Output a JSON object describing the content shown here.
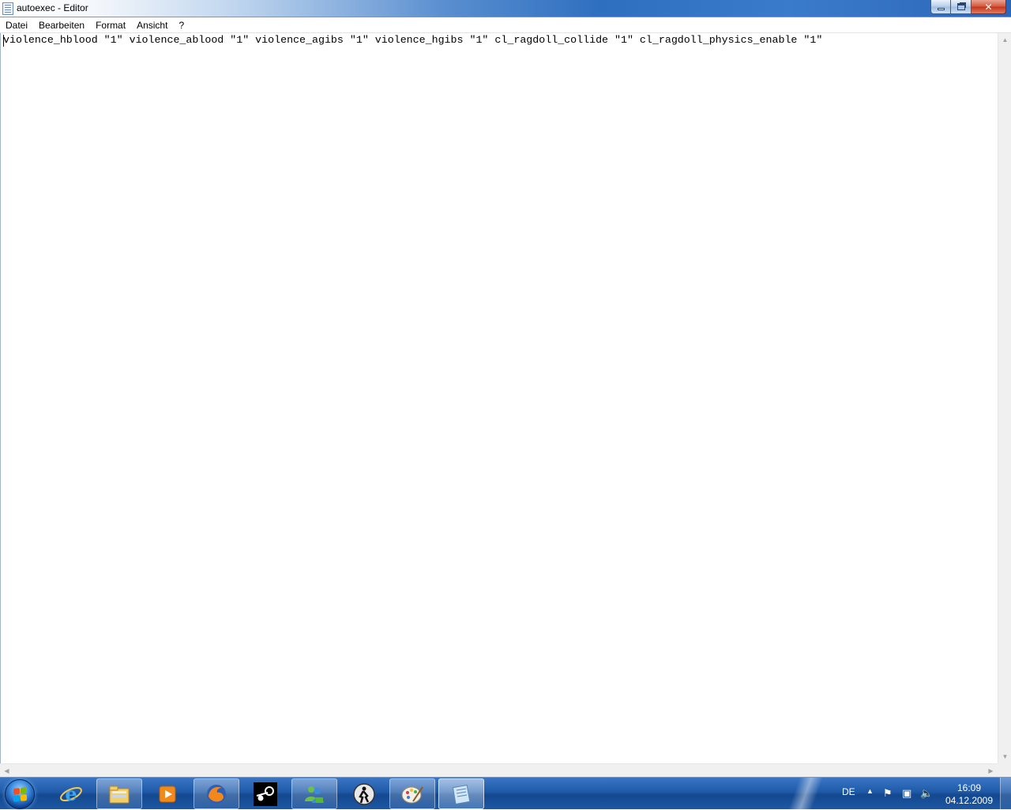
{
  "window": {
    "title": "autoexec - Editor"
  },
  "menu": [
    "Datei",
    "Bearbeiten",
    "Format",
    "Ansicht",
    "?"
  ],
  "editor": {
    "content": "violence_hblood \"1\" violence_ablood \"1\" violence_agibs \"1\" violence_hgibs \"1\" cl_ragdoll_collide \"1\" cl_ragdoll_physics_enable \"1\""
  },
  "taskbar": {
    "apps": [
      {
        "name": "internet-explorer-icon",
        "state": "pinned"
      },
      {
        "name": "windows-explorer-icon",
        "state": "open"
      },
      {
        "name": "media-player-icon",
        "state": "pinned"
      },
      {
        "name": "firefox-icon",
        "state": "open"
      },
      {
        "name": "steam-icon",
        "state": "pinned"
      },
      {
        "name": "messenger-icon",
        "state": "open"
      },
      {
        "name": "counter-strike-icon",
        "state": "pinned"
      },
      {
        "name": "paint-icon",
        "state": "open"
      },
      {
        "name": "notepad-icon",
        "state": "active"
      }
    ],
    "language": "DE",
    "clock": {
      "time": "16:09",
      "date": "04.12.2009"
    }
  },
  "colors": {
    "taskbar": "#1f5aa8",
    "titlebar_accent": "#3b7bcb",
    "close_button": "#c4351b"
  }
}
